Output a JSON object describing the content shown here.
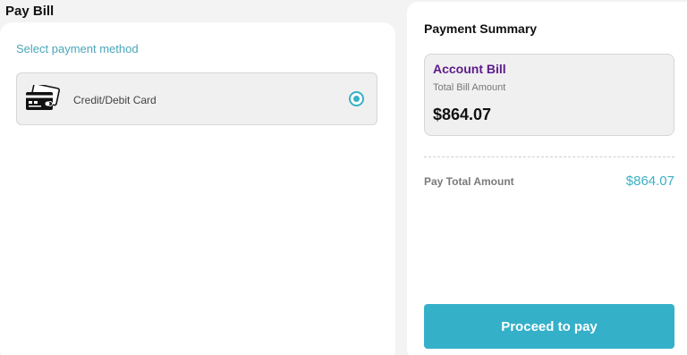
{
  "page": {
    "title": "Pay Bill"
  },
  "payment_method": {
    "section_label": "Select payment method",
    "options": [
      {
        "label": "Credit/Debit Card",
        "icon": "credit-card-icon",
        "selected": true
      }
    ]
  },
  "summary": {
    "title": "Payment Summary",
    "bill": {
      "title": "Account Bill",
      "subtitle": "Total Bill Amount",
      "amount": "$864.07"
    },
    "pay_total_label": "Pay Total Amount",
    "pay_total_amount": "$864.07",
    "proceed_label": "Proceed to pay"
  },
  "colors": {
    "accent": "#35b0c9",
    "bill_title": "#5c1a8a",
    "section_label": "#4aa6b8"
  }
}
